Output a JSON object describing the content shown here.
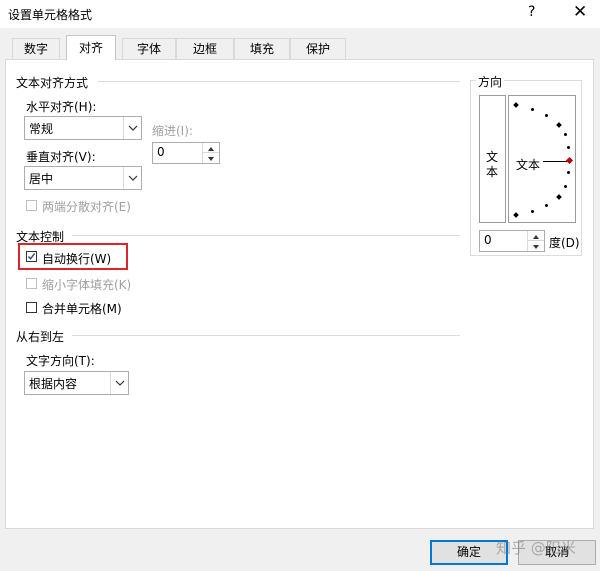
{
  "window": {
    "title": "设置单元格格式",
    "help_icon": "?",
    "close_icon": "✕"
  },
  "tabs": [
    {
      "label": "数字"
    },
    {
      "label": "对齐"
    },
    {
      "label": "字体"
    },
    {
      "label": "边框"
    },
    {
      "label": "填充"
    },
    {
      "label": "保护"
    }
  ],
  "active_tab": "对齐",
  "text_alignment": {
    "group_label": "文本对齐方式",
    "horizontal": {
      "label": "水平对齐(H):",
      "value": "常规"
    },
    "indent": {
      "label": "缩进(I):",
      "value": "0"
    },
    "vertical": {
      "label": "垂直对齐(V):",
      "value": "居中"
    },
    "justify_distributed": {
      "label": "两端分散对齐(E)",
      "checked": false,
      "enabled": false
    }
  },
  "text_control": {
    "group_label": "文本控制",
    "wrap_text": {
      "label": "自动换行(W)",
      "checked": true
    },
    "shrink_to_fit": {
      "label": "缩小字体填充(K)",
      "checked": false,
      "enabled": false
    },
    "merge_cells": {
      "label": "合并单元格(M)",
      "checked": false
    }
  },
  "rtl": {
    "group_label": "从右到左",
    "direction": {
      "label": "文字方向(T):",
      "value": "根据内容"
    }
  },
  "orientation": {
    "group_label": "方向",
    "vertical_text": [
      "文",
      "本"
    ],
    "dial_text": "文本",
    "degrees": {
      "value": "0",
      "label": "度(D)"
    }
  },
  "buttons": {
    "ok": "确定",
    "cancel": "取消"
  },
  "watermark": "知乎 @阳米",
  "colors": {
    "highlight": "#d9262c",
    "accent": "#0078d7",
    "check": "#1f4e79"
  }
}
